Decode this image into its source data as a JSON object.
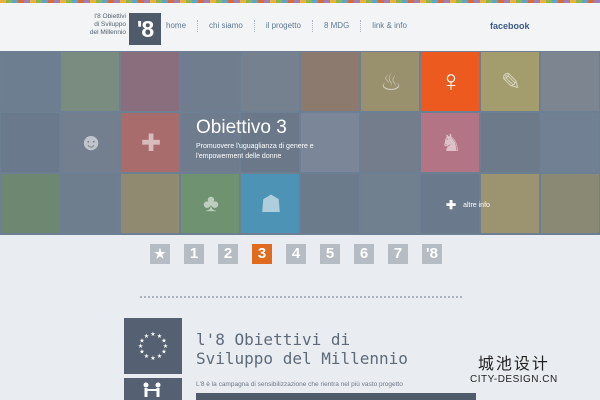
{
  "logo": {
    "lines": [
      "l'8 Obiettivi",
      "di Sviluppo",
      "del Millennio"
    ],
    "mark": "'8"
  },
  "nav": {
    "items": [
      "home",
      "chi siamo",
      "il progetto",
      "8 MDG",
      "link & info"
    ],
    "facebook": "facebook"
  },
  "hero": {
    "title": "Obiettivo 3",
    "description": "Promuovere l'uguaglianza di genere e l'empowerment delle donne",
    "more_label": "altre info"
  },
  "tiles": [
    {
      "row": 0,
      "col": 0,
      "color": "#6d7e90",
      "icon": ""
    },
    {
      "row": 0,
      "col": 1,
      "color": "#7a8b80",
      "icon": ""
    },
    {
      "row": 0,
      "col": 2,
      "color": "#8a6e7e",
      "icon": ""
    },
    {
      "row": 0,
      "col": 3,
      "color": "#6f7d8f",
      "icon": ""
    },
    {
      "row": 0,
      "col": 4,
      "color": "#768190",
      "icon": ""
    },
    {
      "row": 0,
      "col": 5,
      "color": "#8c7a6f",
      "icon": ""
    },
    {
      "row": 0,
      "col": 6,
      "color": "#99906d",
      "icon": "bowl-icon"
    },
    {
      "row": 0,
      "col": 7,
      "color": "#ec5a20",
      "icon": "female-symbol-icon"
    },
    {
      "row": 0,
      "col": 8,
      "color": "#a39d6e",
      "icon": "pencil-icon"
    },
    {
      "row": 0,
      "col": 9,
      "color": "#7d8591",
      "icon": ""
    },
    {
      "row": 1,
      "col": 0,
      "color": "#6a7a8c",
      "icon": ""
    },
    {
      "row": 1,
      "col": 1,
      "color": "#737f8f",
      "icon": "teddy-bear-icon"
    },
    {
      "row": 1,
      "col": 2,
      "color": "#a86c6c",
      "icon": "medicine-jar-icon"
    },
    {
      "row": 1,
      "col": 3,
      "color": "#6e7c8e",
      "icon": ""
    },
    {
      "row": 1,
      "col": 4,
      "color": "#6a7889",
      "icon": ""
    },
    {
      "row": 1,
      "col": 5,
      "color": "#7b8798",
      "icon": ""
    },
    {
      "row": 1,
      "col": 6,
      "color": "#747d8c",
      "icon": ""
    },
    {
      "row": 1,
      "col": 7,
      "color": "#b37586",
      "icon": "mother-child-icon"
    },
    {
      "row": 1,
      "col": 8,
      "color": "#6d7a8a",
      "icon": ""
    },
    {
      "row": 1,
      "col": 9,
      "color": "#728093",
      "icon": ""
    },
    {
      "row": 2,
      "col": 0,
      "color": "#6d8770",
      "icon": ""
    },
    {
      "row": 2,
      "col": 1,
      "color": "#6f7e8f",
      "icon": ""
    },
    {
      "row": 2,
      "col": 2,
      "color": "#8f8a70",
      "icon": ""
    },
    {
      "row": 2,
      "col": 3,
      "color": "#6f9270",
      "icon": "clover-icon"
    },
    {
      "row": 2,
      "col": 4,
      "color": "#4c93b5",
      "icon": "people-group-icon"
    },
    {
      "row": 2,
      "col": 5,
      "color": "#6c7b8c",
      "icon": ""
    },
    {
      "row": 2,
      "col": 6,
      "color": "#71808f",
      "icon": ""
    },
    {
      "row": 2,
      "col": 7,
      "color": "#6a7a8c",
      "icon": ""
    },
    {
      "row": 2,
      "col": 8,
      "color": "#9c9470",
      "icon": ""
    },
    {
      "row": 2,
      "col": 9,
      "color": "#8a8a74",
      "icon": ""
    }
  ],
  "pager": {
    "items": [
      "★",
      "1",
      "2",
      "3",
      "4",
      "5",
      "6",
      "7",
      "'8"
    ],
    "active_index": 3,
    "active_color": "#e06a1e"
  },
  "mission": {
    "title_line1": "l'8 Obiettivi di",
    "title_line2": "Sviluppo del Millennio",
    "text": "L'8 è la campagna di sensibilizzazione che rientra nel più vasto progetto"
  },
  "watermark": {
    "cn": "城池设计",
    "en": "CITY-DESIGN.CN"
  },
  "colors": {
    "accent": "#e06a1e",
    "header_bg": "#f2f4f6",
    "nav_text": "#5d7a93",
    "dark_box": "#556172"
  }
}
